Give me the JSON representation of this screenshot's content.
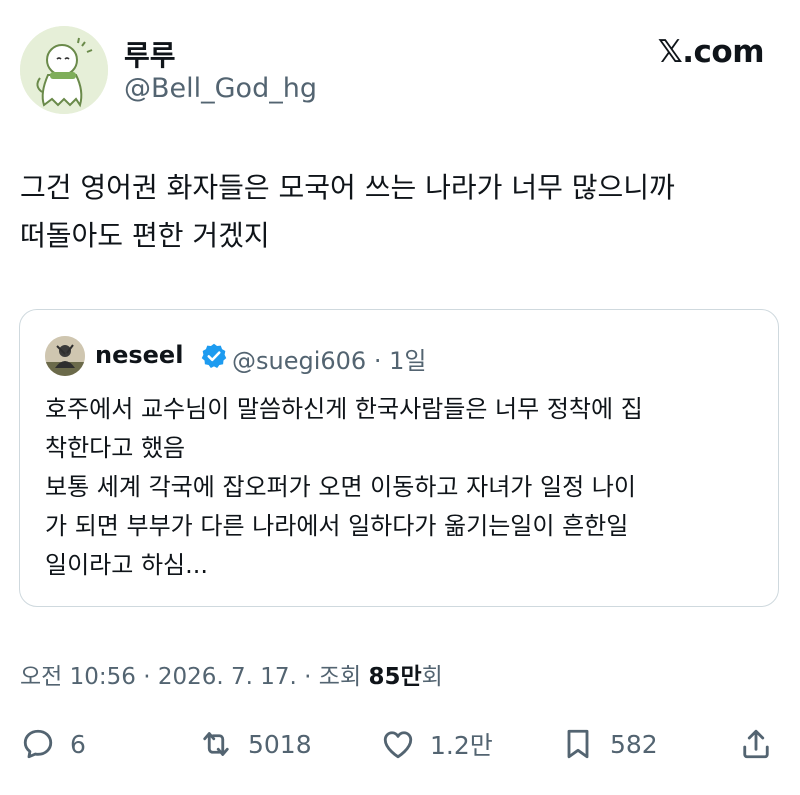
{
  "author": {
    "display_name": "루루",
    "handle": "@Bell_God_hg"
  },
  "brand": "𝕏.com",
  "tweet": {
    "lines": [
      "그건 영어권 화자들은 모국어 쓰는 나라가 너무 많으니까",
      "떠돌아도 편한 거겠지"
    ]
  },
  "quote": {
    "name": "neseel",
    "handle": "@suegi606",
    "time": "1일",
    "lines": [
      "호주에서 교수님이 말씀하신게 한국사람들은 너무 정착에 집",
      "착한다고 했음",
      "보통 세계 각국에 잡오퍼가 오면 이동하고 자녀가 일정 나이",
      "가 되면 부부가 다른 나라에서 일하다가 옮기는일이 흔한일",
      "일이라고 하심..."
    ]
  },
  "meta": {
    "time": "오전 10:56",
    "date": "2026. 7. 17.",
    "views_label": "조회",
    "views_count": "85만",
    "views_unit": "회"
  },
  "actions": {
    "replies": "6",
    "reposts": "5018",
    "likes": "1.2만",
    "bookmarks": "582"
  },
  "colors": {
    "text": "#0f1419",
    "secondary": "#536471",
    "border": "#cfd9de",
    "verified": "#1d9bf0"
  }
}
